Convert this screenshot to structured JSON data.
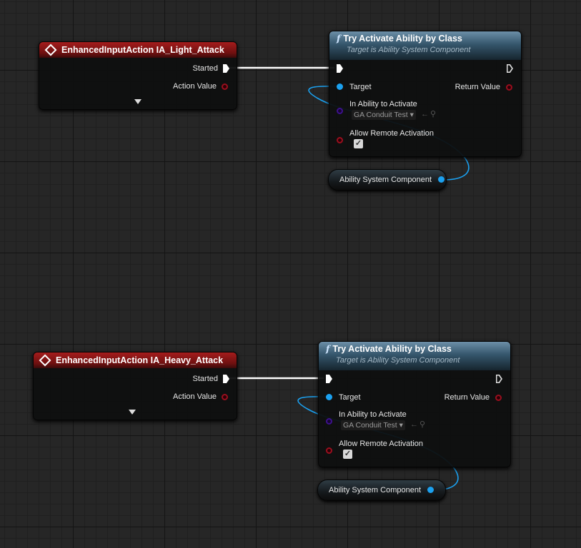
{
  "graphs": [
    {
      "event_node": {
        "title": "EnhancedInputAction IA_Light_Attack",
        "pins": {
          "started": "Started",
          "action_value": "Action Value"
        }
      },
      "function_node": {
        "title": "Try Activate Ability by Class",
        "subtitle": "Target is Ability System Component",
        "pins": {
          "target": "Target",
          "return_value": "Return Value",
          "in_ability": "In Ability to Activate",
          "allow_remote": "Allow Remote Activation"
        },
        "ability_class_value": "GA Conduit Test",
        "allow_remote_checked": true
      },
      "getter_node": {
        "label": "Ability System Component"
      }
    },
    {
      "event_node": {
        "title": "EnhancedInputAction IA_Heavy_Attack",
        "pins": {
          "started": "Started",
          "action_value": "Action Value"
        }
      },
      "function_node": {
        "title": "Try Activate Ability by Class",
        "subtitle": "Target is Ability System Component",
        "pins": {
          "target": "Target",
          "return_value": "Return Value",
          "in_ability": "In Ability to Activate",
          "allow_remote": "Allow Remote Activation"
        },
        "ability_class_value": "GA Conduit Test",
        "allow_remote_checked": true
      },
      "getter_node": {
        "label": "Ability System Component"
      }
    }
  ],
  "colors": {
    "exec_wire": "#ffffff",
    "object_wire": "#1ba1f0",
    "event_header": "#a51c1c",
    "function_header": "#4f7690"
  }
}
